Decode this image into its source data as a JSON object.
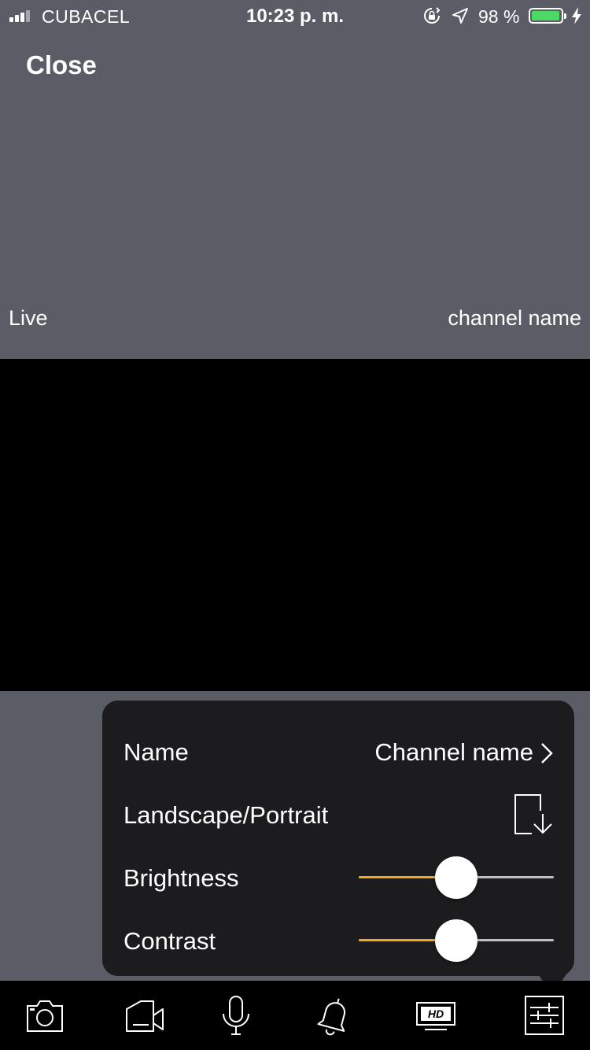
{
  "status_bar": {
    "carrier": "CUBACEL",
    "time": "10:23 p. m.",
    "battery_percent": "98 %",
    "battery_level": 0.98,
    "signal_bars": 3,
    "battery_color": "#4cd964"
  },
  "header": {
    "close_label": "Close",
    "live_label": "Live",
    "channel_label": "channel name"
  },
  "settings": {
    "name_label": "Name",
    "name_value": "Channel name",
    "orientation_label": "Landscape/Portrait",
    "brightness_label": "Brightness",
    "brightness_value": 0.5,
    "contrast_label": "Contrast",
    "contrast_value": 0.5,
    "accent_color": "#f5a623"
  },
  "toolbar": {
    "items": [
      "camera-icon",
      "record-video-icon",
      "microphone-icon",
      "alarm-bell-icon",
      "hd-icon",
      "settings-sliders-icon"
    ]
  }
}
